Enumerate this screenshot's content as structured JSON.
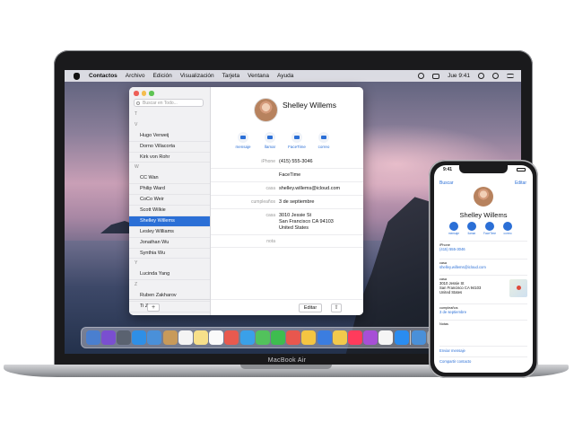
{
  "mac": {
    "menubar": {
      "items": [
        "Contactos",
        "Archivo",
        "Edición",
        "Visualización",
        "Tarjeta",
        "Ventana",
        "Ayuda"
      ],
      "clock": "Jue 9:41"
    },
    "contacts": {
      "search_placeholder": "Buscar en Todo...",
      "list": [
        {
          "type": "header",
          "text": "T"
        },
        {
          "type": "header",
          "text": "V"
        },
        {
          "type": "item",
          "text": "Hugo Verweij"
        },
        {
          "type": "item",
          "text": "Dorno Villacorta"
        },
        {
          "type": "item",
          "text": "Kirk von Rohr"
        },
        {
          "type": "header",
          "text": "W"
        },
        {
          "type": "item",
          "text": "CC Wan"
        },
        {
          "type": "item",
          "text": "Philip Ward"
        },
        {
          "type": "item",
          "text": "CoCo Weir"
        },
        {
          "type": "item",
          "text": "Scott Wilkie"
        },
        {
          "type": "item",
          "text": "Shelley Willems",
          "selected": true
        },
        {
          "type": "item",
          "text": "Lesley Williams"
        },
        {
          "type": "item",
          "text": "Jonathan Wu"
        },
        {
          "type": "item",
          "text": "Synthia Wu"
        },
        {
          "type": "header",
          "text": "Y"
        },
        {
          "type": "item",
          "text": "Lucinda Yang"
        },
        {
          "type": "header",
          "text": "Z"
        },
        {
          "type": "item",
          "text": "Ruben Zakharov"
        },
        {
          "type": "item",
          "text": "Ti Zhao"
        }
      ],
      "add_label": "+",
      "detail": {
        "name": "Shelley Willems",
        "actions": [
          "mensaje",
          "llamar",
          "FaceTime",
          "correo"
        ],
        "fields": [
          {
            "key": "iPhone",
            "value": "(415) 555-3046"
          },
          {
            "key": "",
            "value": "FaceTime"
          },
          {
            "key": "casa",
            "value": "shelley.willems@icloud.com"
          },
          {
            "key": "cumpleaños",
            "value": "3 de septiembre"
          },
          {
            "key": "casa",
            "value": "3010 Jessie St\nSan Francisco CA 94103\nUnited States"
          },
          {
            "key": "nota",
            "value": ""
          }
        ],
        "edit_label": "Editar",
        "share_label": "⇧"
      }
    },
    "dock_colors": [
      "#4a7fcf",
      "#7a4fd0",
      "#5a6270",
      "#2f8fe6",
      "#4a90d9",
      "#c89a5a",
      "#f4f4f4",
      "#f7e08a",
      "#fafafa",
      "#e85a4f",
      "#3aa0e8",
      "#52c25c",
      "#3ebd4f",
      "#e8574e",
      "#f4c542",
      "#3b7de0",
      "#f2c94c",
      "#ff3b5c",
      "#a74fd6",
      "#f5f5f5",
      "#2a8cf0",
      "#4a90d9",
      "#9aa0a8"
    ],
    "label": "MacBook Air"
  },
  "iphone": {
    "time": "9:41",
    "back": "Buscar",
    "edit": "Editar",
    "name": "Shelley Willems",
    "actions": [
      "mensaje",
      "llamar",
      "FaceTime",
      "correo"
    ],
    "phone_key": "iPhone",
    "phone": "(415) 555-3046",
    "email_key": "casa",
    "email": "shelley.willems@icloud.com",
    "address_key": "casa",
    "address": "3010 Jessie St\nSan Francisco CA 94103\nUnited States",
    "birthday_key": "cumpleaños",
    "birthday": "3 de septiembre",
    "notes_key": "Notas",
    "send_message": "Enviar mensaje",
    "share_contact": "Compartir contacto"
  },
  "colors": {
    "accent": "#2b6fd6",
    "traffic": [
      "#ee5f57",
      "#f5bd4f",
      "#5fc454"
    ]
  }
}
